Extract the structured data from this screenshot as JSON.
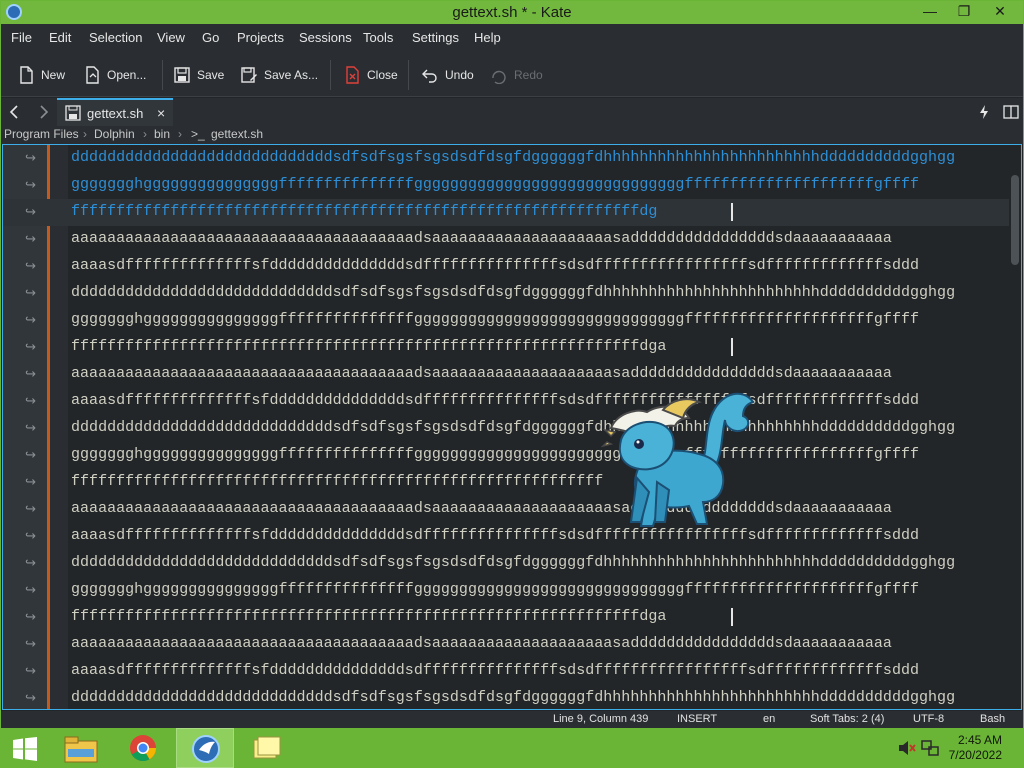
{
  "window": {
    "title": "gettext.sh * - Kate"
  },
  "menu": [
    "File",
    "Edit",
    "Selection",
    "View",
    "Go",
    "Projects",
    "Sessions",
    "Tools",
    "Settings",
    "Help"
  ],
  "toolbar": {
    "new": "New",
    "open": "Open...",
    "save": "Save",
    "save_as": "Save As...",
    "close": "Close",
    "undo": "Undo",
    "redo": "Redo"
  },
  "tab": {
    "label": "gettext.sh",
    "close": "×"
  },
  "breadcrumb": {
    "p1": "Program Files",
    "p2": "Dolphin",
    "p3": "bin",
    "p4": "gettext.sh",
    "sep": "›"
  },
  "editor": {
    "wrap_glyph": "↪",
    "lines": [
      "dddddddddddddddddddddddddddddsdfsdfsgsfsgsdsdfdsgfdggggggfdhhhhhhhhhhhhhhhhhhhhhhhhddddddddddgghgg",
      "ggggggghgggggggggggggggfffffffffffffffggggggggggggggggggggggggggggggfffffffffffffffffffffgffff",
      "fffffffffffffffffffffffffffffffffffffffffffffffffffffffffffffffdg",
      "aaaaaaaaaaaaaaaaaaaaaaaaaaaaaaaaaaaaaadsaaaaaaaaaaaaaaaaaaaasaddddddddddddddddsdaaaaaaaaaaa",
      "aaaasdffffffffffffffsfdddddddddddddddsdfffffffffffffffsdsdfffffffffffffffffsdfffffffffffffsddd",
      "dddddddddddddddddddddddddddddsdfsdfsgsfsgsdsdfdsgfdggggggfdhhhhhhhhhhhhhhhhhhhhhhhhddddddddddgghgg",
      "ggggggghgggggggggggggggfffffffffffffffggggggggggggggggggggggggggggggfffffffffffffffffffffgffff",
      "fffffffffffffffffffffffffffffffffffffffffffffffffffffffffffffffdga",
      "aaaaaaaaaaaaaaaaaaaaaaaaaaaaaaaaaaaaaadsaaaaaaaaaaaaaaaaaaaasaddddddddddddddddsdaaaaaaaaaaa",
      "aaaasdffffffffffffffsfdddddddddddddddsdfffffffffffffffsdsdfffffffffffffffffsdfffffffffffffsddd",
      "dddddddddddddddddddddddddddddsdfsdfsgsfsgsdsdfdsgfdggggggfdhhhhhhhhhhhhhhhhhhhhhhhhddddddddddgghgg",
      "ggggggghgggggggggggggggfffffffffffffffggggggggggggggggggggggggggggggfffffffffffffffffffffgffff",
      "fffffffffffffffffffffffffffffffffffffffffffffffffffffffffff",
      "aaaaaaaaaaaaaaaaaaaaaaaaaaaaaaaaaaaaaadsaaaaaaaaaaaaaaaaaaaasaddddddddddddddddsdaaaaaaaaaaa",
      "aaaasdffffffffffffffsfdddddddddddddddsdfffffffffffffffsdsdfffffffffffffffffsdfffffffffffffsddd",
      "dddddddddddddddddddddddddddddsdfsdfsgsfsgsdsdfdsgfdggggggfdhhhhhhhhhhhhhhhhhhhhhhhhddddddddddgghgg",
      "ggggggghgggggggggggggggfffffffffffffffggggggggggggggggggggggggggggggfffffffffffffffffffffgffff",
      "fffffffffffffffffffffffffffffffffffffffffffffffffffffffffffffffdga",
      "aaaaaaaaaaaaaaaaaaaaaaaaaaaaaaaaaaaaaadsaaaaaaaaaaaaaaaaaaaasaddddddddddddddddsdaaaaaaaaaaa",
      "aaaasdffffffffffffffsfdddddddddddddddsdfffffffffffffffsdsdfffffffffffffffffsdfffffffffffffsddd",
      "dddddddddddddddddddddddddddddsdfsdfsgsfsgsdsdfdsgfdggggggfdhhhhhhhhhhhhhhhhhhhhhhhhddddddddddgghgg"
    ]
  },
  "status": {
    "position": "Line 9, Column 439",
    "mode": "INSERT",
    "lang": "en",
    "tabs": "Soft Tabs: 2 (4)",
    "encoding": "UTF-8",
    "syntax": "Bash"
  },
  "taskbar": {
    "time": "2:45 AM",
    "date": "7/20/2022"
  },
  "colors": {
    "accent": "#3daee9",
    "title_bar": "#72b83f",
    "taskbar": "#6bb536",
    "fold_marker": "#c45a1e"
  }
}
